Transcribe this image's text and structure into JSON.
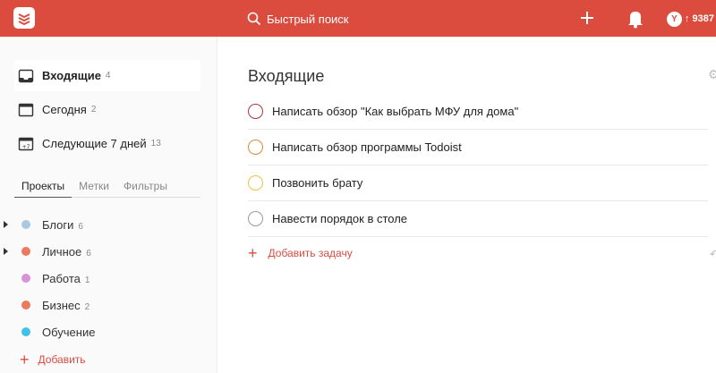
{
  "colors": {
    "brand": "#db4c3f",
    "sidebar_bg": "#fafafa"
  },
  "topbar": {
    "search_placeholder": "Быстрый поиск",
    "karma_avatar": "Y",
    "karma_value": "↑ 9387",
    "icons": [
      "logo-icon",
      "search-icon",
      "plus-icon",
      "bell-icon"
    ]
  },
  "sidebar": {
    "filters": [
      {
        "label": "Входящие",
        "count": "4",
        "icon": "inbox-icon"
      },
      {
        "label": "Сегодня",
        "count": "2",
        "icon": "calendar-icon"
      },
      {
        "label": "Следующие 7 дней",
        "count": "13",
        "icon": "calendar-week-icon"
      }
    ],
    "tabs": [
      "Проекты",
      "Метки",
      "Фильтры"
    ],
    "projects": [
      {
        "name": "Блоги",
        "count": "6",
        "color": "#a8c8e4",
        "expandable": true
      },
      {
        "name": "Личное",
        "count": "6",
        "color": "#eb7a5e",
        "expandable": true
      },
      {
        "name": "Работа",
        "count": "1",
        "color": "#db91d8",
        "expandable": false
      },
      {
        "name": "Бизнес",
        "count": "2",
        "color": "#eb7a5e",
        "expandable": false
      },
      {
        "name": "Обучение",
        "count": "",
        "color": "#3fc1e8",
        "expandable": false
      }
    ],
    "add_project_label": "Добавить"
  },
  "main": {
    "title": "Входящие",
    "tasks": [
      {
        "text": "Написать обзор \"Как выбрать МФУ для дома\"",
        "priority_color": "#b03244"
      },
      {
        "text": "Написать обзор программы Todoist",
        "priority_color": "#e0883a"
      },
      {
        "text": "Позвонить брату",
        "priority_color": "#f0c13e"
      },
      {
        "text": "Навести порядок в столе",
        "priority_color": "#999999"
      }
    ],
    "add_task_label": "Добавить задачу"
  }
}
